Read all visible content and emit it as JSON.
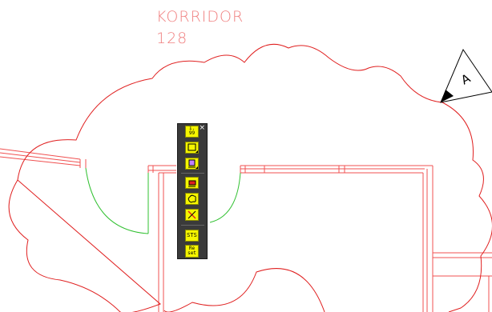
{
  "drawing": {
    "room_name": "KORRIDOR",
    "room_number": "128",
    "section_marker": "A"
  },
  "toolbar": {
    "close_glyph": "×",
    "tools": [
      {
        "id": "tool-1",
        "label": "1.\n99",
        "icon": "numbering-icon"
      },
      {
        "id": "tool-2",
        "icon": "rectangle-icon"
      },
      {
        "id": "tool-3",
        "icon": "layer-stack-icon"
      },
      {
        "id": "tool-4",
        "icon": "red-block-icon"
      },
      {
        "id": "tool-5",
        "icon": "cloud-icon"
      },
      {
        "id": "tool-6",
        "icon": "erase-cross-icon"
      },
      {
        "id": "tool-7",
        "label": "STS",
        "icon": "sts-icon"
      },
      {
        "id": "tool-8",
        "label": "Re\nset",
        "icon": "reset-icon"
      }
    ]
  },
  "colors": {
    "revision_cloud": "#e02020",
    "walls": "#f05050",
    "door_swing": "#30c030",
    "toolbar_bg": "#3a3a3a",
    "tool_bg": "#f5f500"
  }
}
